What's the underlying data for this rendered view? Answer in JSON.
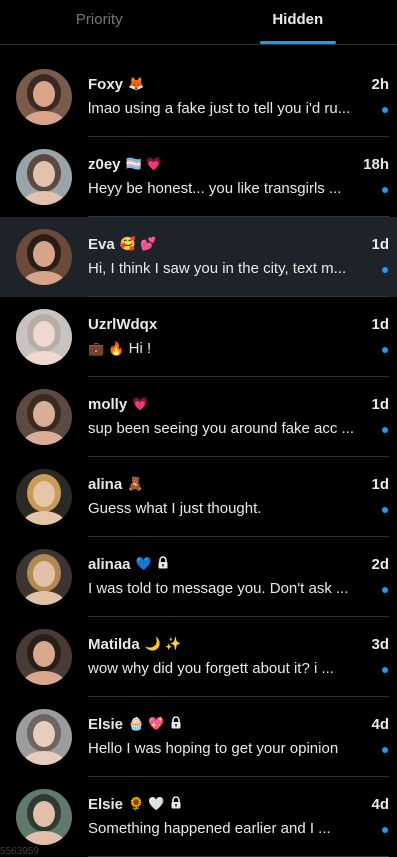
{
  "tabs": [
    {
      "label": "Priority",
      "active": false
    },
    {
      "label": "Hidden",
      "active": true
    }
  ],
  "colors": {
    "accent": "#1d9bf0",
    "highlight_row": "#1e2329",
    "divider": "#2f3336",
    "muted": "#71767b"
  },
  "conversations": [
    {
      "name": "Foxy",
      "badges": "🦊",
      "locked": false,
      "time": "2h",
      "preview": "lmao using a fake just to tell you i'd ru...",
      "unread": true
    },
    {
      "name": "z0ey",
      "badges": "🏳️‍⚧️ 💗",
      "locked": false,
      "time": "18h",
      "preview": "Heyy be honest... you like transgirls ...",
      "unread": true
    },
    {
      "name": "Eva",
      "badges": "🥰 💕",
      "locked": false,
      "time": "1d",
      "preview": "Hi, I think I saw you in the city, text m...",
      "unread": true,
      "highlighted": true
    },
    {
      "name": "UzrlWdqx",
      "badges": "",
      "locked": false,
      "time": "1d",
      "preview_emoji": "💼 🔥",
      "preview": "Hi !",
      "unread": true
    },
    {
      "name": "molly",
      "badges": "💗",
      "locked": false,
      "time": "1d",
      "preview": "sup been seeing you around fake acc ...",
      "unread": true
    },
    {
      "name": "alina",
      "badges": "🧸",
      "locked": false,
      "time": "1d",
      "preview": "Guess what I just thought.",
      "unread": true
    },
    {
      "name": "alinaa",
      "badges": "💙",
      "locked": true,
      "time": "2d",
      "preview": "I was told to message you. Don't ask ...",
      "unread": true
    },
    {
      "name": "Matilda",
      "badges": "🌙 ✨",
      "locked": false,
      "time": "3d",
      "preview": "wow why did you forgett about it? i ...",
      "unread": true
    },
    {
      "name": "Elsie",
      "badges": "🧁 💖",
      "locked": true,
      "time": "4d",
      "preview": "Hello I was hoping to get your opinion",
      "unread": true
    },
    {
      "name": "Elsie",
      "badges": "🌻 🤍",
      "locked": true,
      "time": "4d",
      "preview": "Something happened earlier and I ...",
      "unread": true
    }
  ],
  "footer_text": "5563959"
}
